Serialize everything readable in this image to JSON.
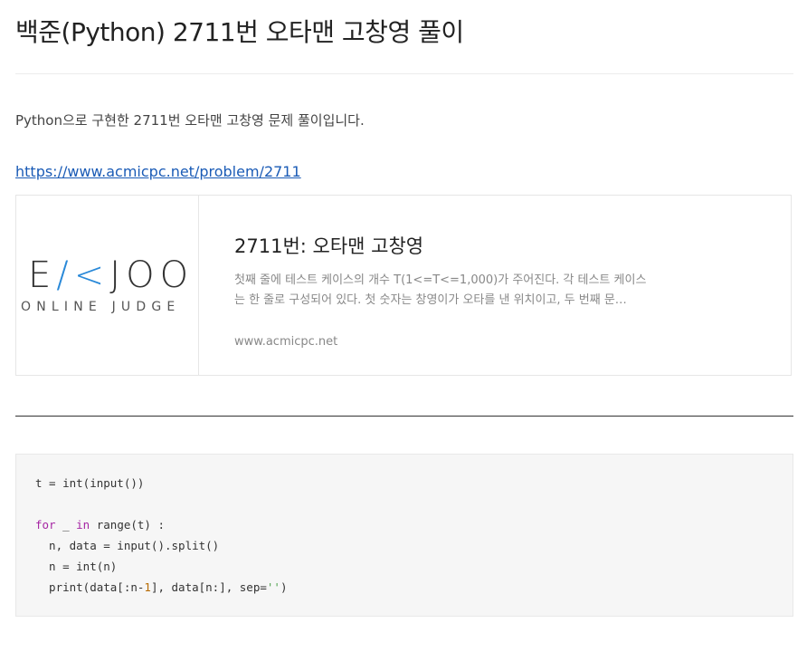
{
  "post": {
    "title": "백준(Python) 2711번 오타맨 고창영 풀이",
    "intro": "Python으로 구현한 2711번 오타맨 고창영 문제 풀이입니다.",
    "link_text": "https://www.acmicpc.net/problem/2711"
  },
  "link_card": {
    "logo_main_left": "E",
    "logo_main_accent": "/<",
    "logo_main_right": "JOO",
    "logo_sub": "ONLINE JUDGE",
    "title": "2711번: 오타맨 고창영",
    "description_line1": "첫째 줄에 테스트 케이스의 개수 T(1<=T<=1,000)가 주어진다. 각 테스트 케이스",
    "description_line2": "는 한 줄로 구성되어 있다. 첫 숫자는 창영이가 오타를 낸 위치이고, 두 번째 문…",
    "host": "www.acmicpc.net"
  },
  "code": {
    "language": "python",
    "lines": [
      "t = int(input())",
      "",
      "for _ in range(t) :",
      "  n, data = input().split()",
      "  n = int(n)",
      "  print(data[:n-1], data[n:], sep='')"
    ],
    "colors": {
      "keyword": "#a626a4",
      "number": "#b76b01",
      "string": "#50a14f"
    }
  }
}
